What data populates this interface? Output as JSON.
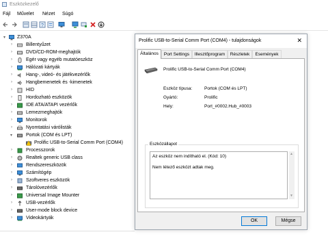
{
  "window": {
    "title": "Eszközkezelő"
  },
  "menu": [
    "Fájl",
    "Művelet",
    "Nézet",
    "Súgó"
  ],
  "toolbar_icons": [
    "back-icon",
    "forward-icon",
    "device-view-icon",
    "help-icon",
    "properties-icon",
    "update-driver-icon",
    "scan-hardware-icon",
    "disable-device-icon",
    "uninstall-device-icon",
    "download-icon"
  ],
  "tree": {
    "root": "Z370A",
    "categories": [
      "Billentyűzet",
      "DVD/CD-ROM-meghajtók",
      "Egér vagy egyéb mutatóeszköz",
      "Hálózati kártyák",
      "Hang-, videó- és játékvezérlők",
      "Hangbemenetek és -kimenetek",
      "HID",
      "Hordozható eszközök",
      "IDE ATA/ATAPI vezérlők",
      "Lemezmeghajtók",
      "Monitorok",
      "Nyomtatási várólisták",
      "Portok (COM és LPT)",
      "Prolific USB-to-Serial Comm Port (COM4)",
      "Processzorok",
      "Realtek generic USB class",
      "Rendszereszközök",
      "Számítógép",
      "Szoftveres eszközök",
      "Tárolóvezérlők",
      "Universal Image Mounter",
      "USB-vezérlők",
      "User-mode block device",
      "Videokártyák"
    ]
  },
  "dialog": {
    "title": "Prolific USB-to-Serial Comm Port (COM4) - tulajdonságok",
    "tabs": [
      "Általános",
      "Port Settings",
      "Illesztőprogram",
      "Részletek",
      "Események"
    ],
    "device_name": "Prolific USB-to-Serial Comm Port (COM4)",
    "fields": [
      {
        "label": "Eszköz típusa:",
        "value": "Portok (COM és LPT)"
      },
      {
        "label": "Gyártó:",
        "value": "Prolific"
      },
      {
        "label": "Hely:",
        "value": "Port_#0002.Hub_#0003"
      }
    ],
    "status_label": "Eszközállapot",
    "status_lines": [
      "Az eszköz nem indítható el. (Kód: 10)",
      "Nem létező eszközt adtak meg."
    ],
    "ok": "OK",
    "cancel": "Mégse"
  },
  "colors": {
    "accent": "#0078d7",
    "error": "#d42020"
  }
}
